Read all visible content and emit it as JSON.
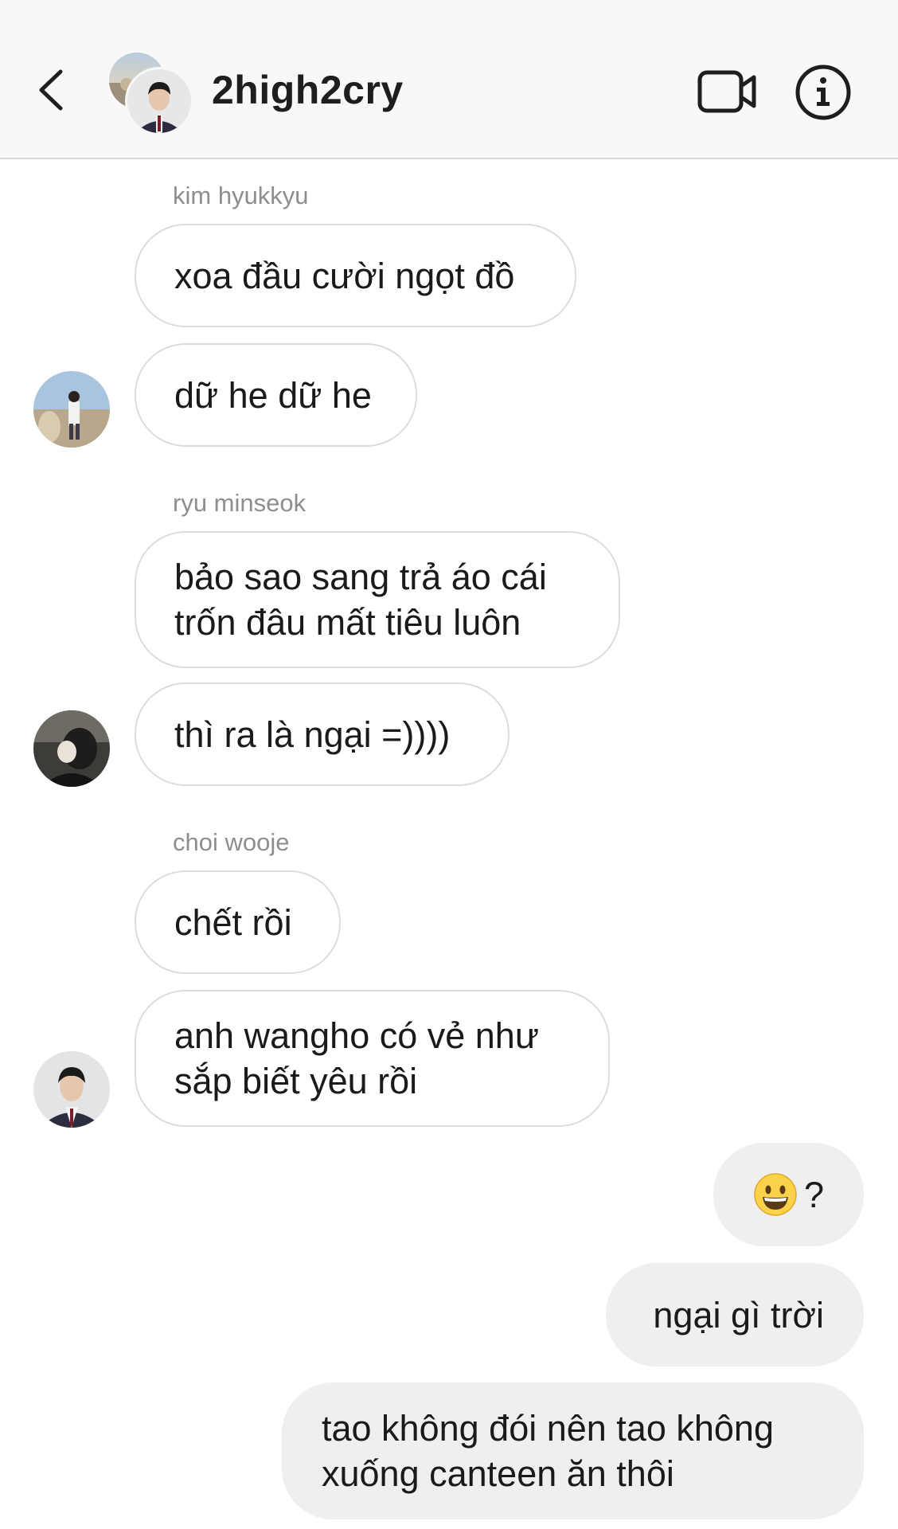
{
  "header": {
    "title": "2high2cry",
    "back_icon": "chevron-left-icon",
    "video_icon": "video-camera-icon",
    "info_icon": "info-icon"
  },
  "messages": [
    {
      "sender": "kim hyukkyu",
      "bubbles": [
        "xoa đầu cười ngọt đồ",
        "dữ he dữ he"
      ]
    },
    {
      "sender": "ryu minseok",
      "bubbles": [
        "bảo sao sang trả áo cái\ntrốn đâu mất tiêu luôn",
        "thì ra là ngại =))))"
      ]
    },
    {
      "sender": "choi wooje",
      "bubbles": [
        "chết rồi",
        "anh wangho có vẻ như\nsắp biết yêu rồi"
      ]
    }
  ],
  "own_messages": [
    {
      "emoji": "grinning-face-emoji",
      "text": "?"
    },
    {
      "text": "ngại gì trời"
    },
    {
      "text": "tao không đói nên tao không\nxuống canteen ăn thôi"
    }
  ],
  "colors": {
    "incoming_bubble_border": "#dcdcdc",
    "outgoing_bubble_bg": "#efefef",
    "sender_name": "#8e8e8e",
    "header_bg": "#f8f8f8"
  }
}
